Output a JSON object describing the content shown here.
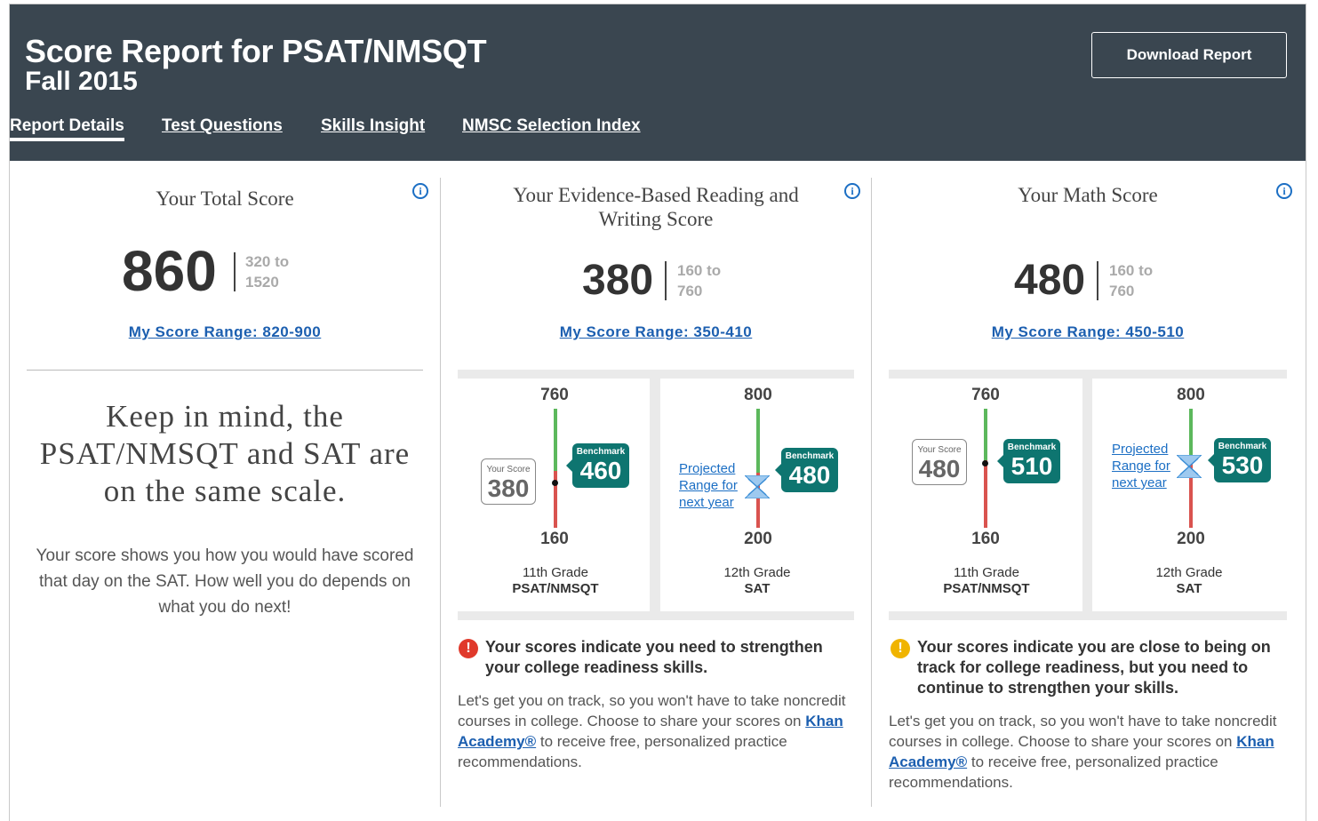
{
  "header": {
    "title": "Score Report for PSAT/NMSQT",
    "subtitle": "Fall 2015",
    "download_label": "Download Report",
    "tabs": [
      {
        "label": "Report Details",
        "active": true
      },
      {
        "label": "Test Questions"
      },
      {
        "label": "Skills Insight"
      },
      {
        "label": "NMSC Selection Index"
      }
    ]
  },
  "total": {
    "title": "Your Total Score",
    "score": "860",
    "range_from": "320 to",
    "range_to": "1520",
    "my_range": "My Score Range: 820-900",
    "note_heading": "Keep in mind, the PSAT/NMSQT and SAT are on the same scale.",
    "note_body": "Your score shows you how you would have scored that day on the SAT. How well you do depends on what you do next!"
  },
  "ebrw": {
    "title": "Your Evidence-Based Reading and Writing Score",
    "score": "380",
    "range_from": "160 to",
    "range_to": "760",
    "my_range": "My Score Range: 350-410",
    "psat": {
      "top": "760",
      "bottom": "160",
      "your_label": "Your Score",
      "your_score": "380",
      "bench_label": "Benchmark",
      "bench": "460",
      "grade": "11th Grade",
      "test": "PSAT/NMSQT"
    },
    "sat": {
      "top": "800",
      "bottom": "200",
      "proj_label": "Projected Range for next year",
      "bench_label": "Benchmark",
      "bench": "480",
      "grade": "12th Grade",
      "test": "SAT"
    },
    "alert": {
      "status": "red",
      "heading": "Your scores indicate you need to strengthen your college readiness skills.",
      "body_pre": "Let's get you on track, so you won't have to take noncredit courses in college. Choose to share your scores on ",
      "khan": "Khan Academy®",
      "body_post": " to receive free, personalized practice recommendations."
    }
  },
  "math": {
    "title": "Your Math Score",
    "score": "480",
    "range_from": "160 to",
    "range_to": "760",
    "my_range": "My Score Range: 450-510",
    "psat": {
      "top": "760",
      "bottom": "160",
      "your_label": "Your Score",
      "your_score": "480",
      "bench_label": "Benchmark",
      "bench": "510",
      "grade": "11th Grade",
      "test": "PSAT/NMSQT"
    },
    "sat": {
      "top": "800",
      "bottom": "200",
      "proj_label": "Projected Range for next year",
      "bench_label": "Benchmark",
      "bench": "530",
      "grade": "12th Grade",
      "test": "SAT"
    },
    "alert": {
      "status": "yellow",
      "heading": "Your scores indicate you are close to being on track for college readiness, but you need to continue to strengthen your skills.",
      "body_pre": "Let's get you on track, so you won't have to take noncredit courses in college. Choose to share your scores on ",
      "khan": "Khan Academy®",
      "body_post": " to receive free, personalized practice recommendations."
    }
  },
  "colors": {
    "header_bg": "#3a4650",
    "benchmark": "#0e7570",
    "on_track": "#5cb85c",
    "below": "#d9534f",
    "link": "#1c5fb0",
    "alert_red": "#e0392b",
    "alert_yellow": "#f0b400"
  }
}
